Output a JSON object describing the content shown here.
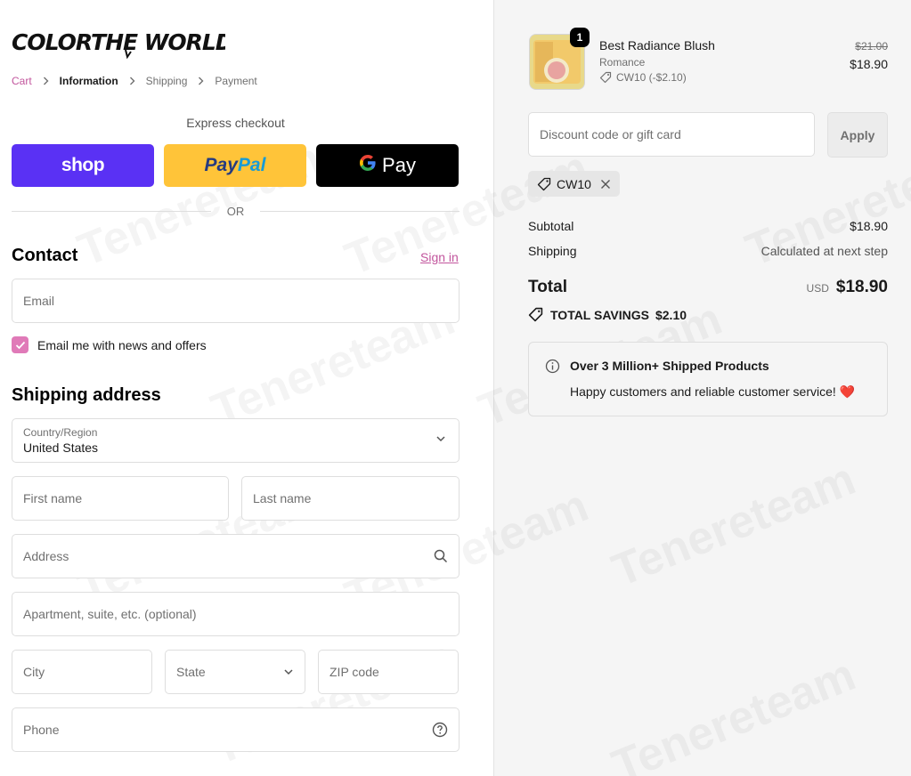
{
  "brand": {
    "logo_text": "COLORTHE WORLD"
  },
  "breadcrumb": {
    "items": [
      {
        "label": "Cart"
      },
      {
        "label": "Information"
      },
      {
        "label": "Shipping"
      },
      {
        "label": "Payment"
      }
    ]
  },
  "express": {
    "title": "Express checkout",
    "shop_label": "shop",
    "paypal_part1": "Pay",
    "paypal_part2": "Pal",
    "gpay_g": "G",
    "gpay_label": "Pay",
    "divider_text": "OR"
  },
  "contact": {
    "title": "Contact",
    "signin_label": "Sign in",
    "email_placeholder": "Email",
    "news_checkbox_label": "Email me with news and offers",
    "news_checked": true
  },
  "shipping_address": {
    "title": "Shipping address",
    "country_label": "Country/Region",
    "country_value": "United States",
    "first_name_placeholder": "First name",
    "last_name_placeholder": "Last name",
    "address_placeholder": "Address",
    "apartment_placeholder": "Apartment, suite, etc. (optional)",
    "city_placeholder": "City",
    "state_placeholder": "State",
    "zip_placeholder": "ZIP code",
    "phone_placeholder": "Phone"
  },
  "order": {
    "item": {
      "quantity": "1",
      "name": "Best Radiance Blush",
      "variant": "Romance",
      "discount": "CW10 (-$2.10)",
      "original_price": "$21.00",
      "price": "$18.90"
    },
    "discount_placeholder": "Discount code or gift card",
    "apply_label": "Apply",
    "applied_code": "CW10",
    "subtotal_label": "Subtotal",
    "subtotal_value": "$18.90",
    "shipping_label": "Shipping",
    "shipping_value": "Calculated at next step",
    "total_label": "Total",
    "currency": "USD",
    "total_value": "$18.90",
    "savings_label": "TOTAL SAVINGS",
    "savings_value": "$2.10",
    "info_title": "Over 3 Million+ Shipped Products",
    "info_text": "Happy customers and reliable customer service!",
    "info_emoji": "❤️"
  },
  "watermark_text": "Tenereteam",
  "colors": {
    "accent": "#c2559d",
    "checkbox": "#e07ab8",
    "shop_pay": "#5a31f4",
    "paypal": "#ffc439",
    "gpay": "#000000"
  }
}
